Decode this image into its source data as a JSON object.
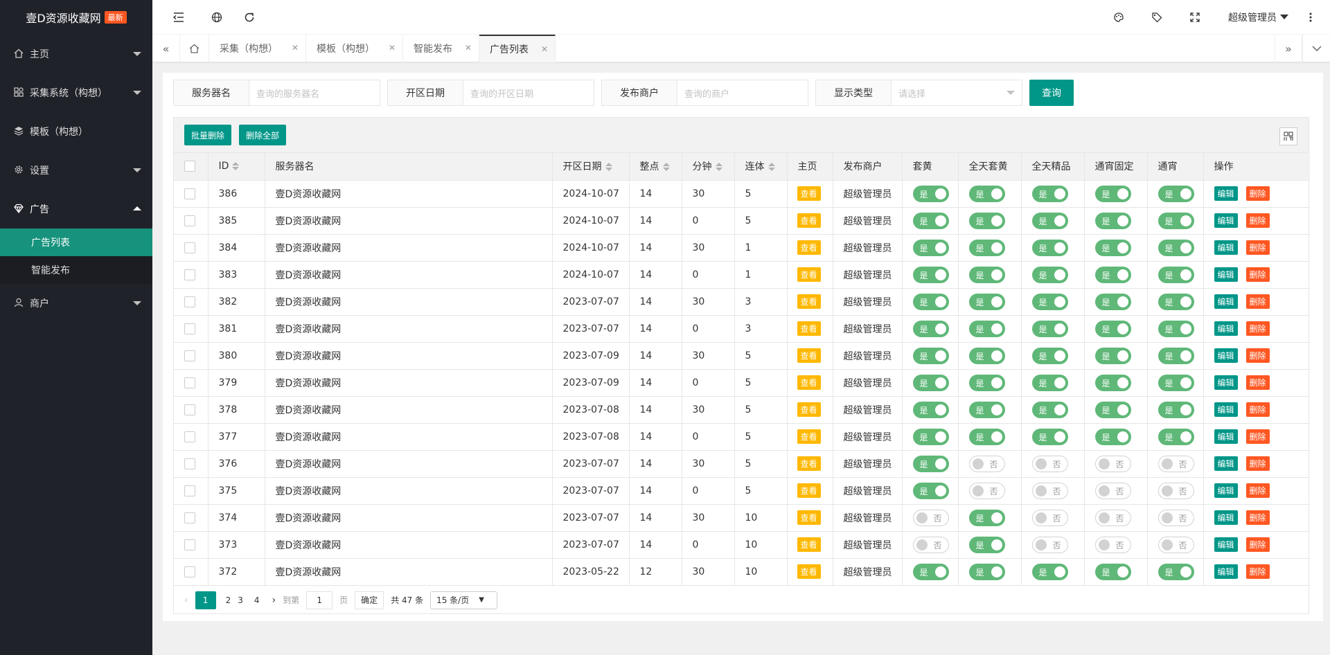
{
  "app": {
    "title": "壹D资源收藏网",
    "badge": "最新"
  },
  "sidebar": {
    "items": [
      {
        "label": "主页",
        "icon": "home-icon"
      },
      {
        "label": "采集系统（构想）",
        "icon": "apps-icon"
      },
      {
        "label": "模板（构想）",
        "icon": "layers-icon"
      },
      {
        "label": "设置",
        "icon": "gear-icon"
      },
      {
        "label": "广告",
        "icon": "diamond-icon"
      }
    ],
    "subitems": [
      "广告列表",
      "智能发布"
    ],
    "last_item": {
      "label": "商户",
      "icon": "user-icon"
    }
  },
  "header": {
    "user": "超级管理员"
  },
  "tabs": [
    "采集（构想）",
    "模板（构想）",
    "智能发布",
    "广告列表"
  ],
  "search": {
    "server_label": "服务器名",
    "server_placeholder": "查询的服务器名",
    "date_label": "开区日期",
    "date_placeholder": "查询的开区日期",
    "merchant_label": "发布商户",
    "merchant_placeholder": "查询的商户",
    "type_label": "显示类型",
    "type_placeholder": "请选择",
    "query_button": "查询"
  },
  "toolbar": {
    "batch_delete": "批量删除",
    "delete_all": "删除全部"
  },
  "table": {
    "headers": [
      "ID",
      "服务器名",
      "开区日期",
      "整点",
      "分钟",
      "连体",
      "主页",
      "发布商户",
      "套黄",
      "全天套黄",
      "全天精品",
      "通宵固定",
      "通宵",
      "操作"
    ],
    "view_label": "查看",
    "on_label": "是",
    "off_label": "否",
    "edit_label": "编辑",
    "delete_label": "删除",
    "rows": [
      {
        "id": "386",
        "name": "壹D资源收藏网",
        "date": "2024-10-07",
        "hour": "14",
        "minute": "30",
        "lian": "5",
        "merchant": "超级管理员",
        "s1": true,
        "s2": true,
        "s3": true,
        "s4": true,
        "s5": true
      },
      {
        "id": "385",
        "name": "壹D资源收藏网",
        "date": "2024-10-07",
        "hour": "14",
        "minute": "0",
        "lian": "5",
        "merchant": "超级管理员",
        "s1": true,
        "s2": true,
        "s3": true,
        "s4": true,
        "s5": true
      },
      {
        "id": "384",
        "name": "壹D资源收藏网",
        "date": "2024-10-07",
        "hour": "14",
        "minute": "30",
        "lian": "1",
        "merchant": "超级管理员",
        "s1": true,
        "s2": true,
        "s3": true,
        "s4": true,
        "s5": true
      },
      {
        "id": "383",
        "name": "壹D资源收藏网",
        "date": "2024-10-07",
        "hour": "14",
        "minute": "0",
        "lian": "1",
        "merchant": "超级管理员",
        "s1": true,
        "s2": true,
        "s3": true,
        "s4": true,
        "s5": true
      },
      {
        "id": "382",
        "name": "壹D资源收藏网",
        "date": "2023-07-07",
        "hour": "14",
        "minute": "30",
        "lian": "3",
        "merchant": "超级管理员",
        "s1": true,
        "s2": true,
        "s3": true,
        "s4": true,
        "s5": true
      },
      {
        "id": "381",
        "name": "壹D资源收藏网",
        "date": "2023-07-07",
        "hour": "14",
        "minute": "0",
        "lian": "3",
        "merchant": "超级管理员",
        "s1": true,
        "s2": true,
        "s3": true,
        "s4": true,
        "s5": true
      },
      {
        "id": "380",
        "name": "壹D资源收藏网",
        "date": "2023-07-09",
        "hour": "14",
        "minute": "30",
        "lian": "5",
        "merchant": "超级管理员",
        "s1": true,
        "s2": true,
        "s3": true,
        "s4": true,
        "s5": true
      },
      {
        "id": "379",
        "name": "壹D资源收藏网",
        "date": "2023-07-09",
        "hour": "14",
        "minute": "0",
        "lian": "5",
        "merchant": "超级管理员",
        "s1": true,
        "s2": true,
        "s3": true,
        "s4": true,
        "s5": true
      },
      {
        "id": "378",
        "name": "壹D资源收藏网",
        "date": "2023-07-08",
        "hour": "14",
        "minute": "30",
        "lian": "5",
        "merchant": "超级管理员",
        "s1": true,
        "s2": true,
        "s3": true,
        "s4": true,
        "s5": true
      },
      {
        "id": "377",
        "name": "壹D资源收藏网",
        "date": "2023-07-08",
        "hour": "14",
        "minute": "0",
        "lian": "5",
        "merchant": "超级管理员",
        "s1": true,
        "s2": true,
        "s3": true,
        "s4": true,
        "s5": true
      },
      {
        "id": "376",
        "name": "壹D资源收藏网",
        "date": "2023-07-07",
        "hour": "14",
        "minute": "30",
        "lian": "5",
        "merchant": "超级管理员",
        "s1": true,
        "s2": false,
        "s3": false,
        "s4": false,
        "s5": false
      },
      {
        "id": "375",
        "name": "壹D资源收藏网",
        "date": "2023-07-07",
        "hour": "14",
        "minute": "0",
        "lian": "5",
        "merchant": "超级管理员",
        "s1": true,
        "s2": false,
        "s3": false,
        "s4": false,
        "s5": false
      },
      {
        "id": "374",
        "name": "壹D资源收藏网",
        "date": "2023-07-07",
        "hour": "14",
        "minute": "30",
        "lian": "10",
        "merchant": "超级管理员",
        "s1": false,
        "s2": true,
        "s3": false,
        "s4": false,
        "s5": false
      },
      {
        "id": "373",
        "name": "壹D资源收藏网",
        "date": "2023-07-07",
        "hour": "14",
        "minute": "0",
        "lian": "10",
        "merchant": "超级管理员",
        "s1": false,
        "s2": true,
        "s3": false,
        "s4": false,
        "s5": false
      },
      {
        "id": "372",
        "name": "壹D资源收藏网",
        "date": "2023-05-22",
        "hour": "12",
        "minute": "30",
        "lian": "10",
        "merchant": "超级管理员",
        "s1": true,
        "s2": true,
        "s3": true,
        "s4": true,
        "s5": true
      }
    ]
  },
  "pager": {
    "pages": [
      "1",
      "2",
      "3",
      "4"
    ],
    "goto_label": "到第",
    "goto_value": "1",
    "page_unit": "页",
    "confirm": "确定",
    "total": "共 47 条",
    "per_page": "15 条/页"
  },
  "colors": {
    "accent": "#009688",
    "sidebar_bg": "#20222a",
    "switch_on": "#5fb878",
    "danger": "#ff5722",
    "warn": "#ffb800"
  }
}
